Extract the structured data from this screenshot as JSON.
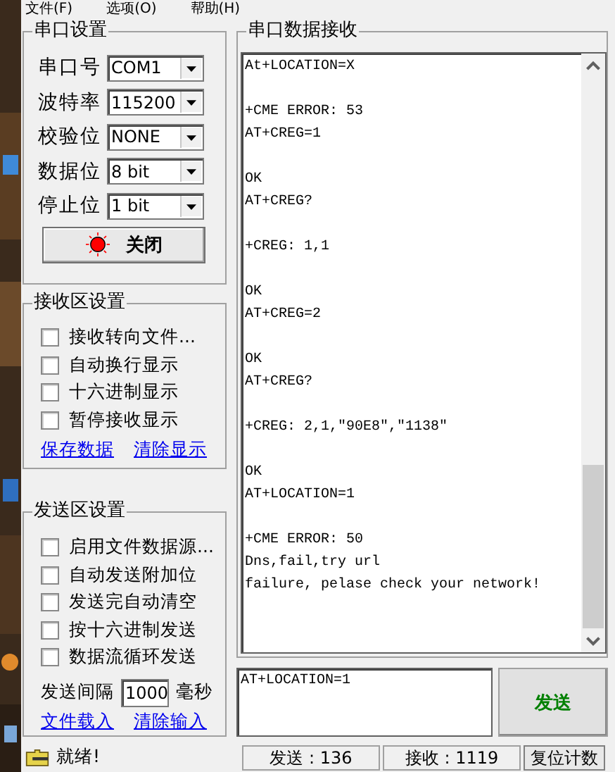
{
  "menu": [
    {
      "label": "文件(F)"
    },
    {
      "label": "选项(O)"
    },
    {
      "label": "帮助(H)"
    }
  ],
  "serial_settings": {
    "title": "串口设置",
    "fields": [
      {
        "label": "串口号",
        "value": "COM1"
      },
      {
        "label": "波特率",
        "value": "115200"
      },
      {
        "label": "校验位",
        "value": "NONE"
      },
      {
        "label": "数据位",
        "value": "8 bit"
      },
      {
        "label": "停止位",
        "value": "1 bit"
      }
    ],
    "port_button": {
      "label": "关闭",
      "on": true
    }
  },
  "receive_settings": {
    "title": "接收区设置",
    "options": [
      {
        "label": "接收转向文件...",
        "checked": false
      },
      {
        "label": "自动换行显示",
        "checked": false
      },
      {
        "label": "十六进制显示",
        "checked": false
      },
      {
        "label": "暂停接收显示",
        "checked": false
      }
    ],
    "links": [
      "保存数据",
      "清除显示"
    ]
  },
  "send_settings": {
    "title": "发送区设置",
    "options": [
      {
        "label": "启用文件数据源...",
        "checked": false
      },
      {
        "label": "自动发送附加位",
        "checked": false
      },
      {
        "label": "发送完自动清空",
        "checked": false
      },
      {
        "label": "按十六进制发送",
        "checked": false
      },
      {
        "label": "数据流循环发送",
        "checked": false
      }
    ],
    "interval": {
      "label": "发送间隔",
      "value": "1000",
      "unit": "毫秒"
    },
    "links": [
      "文件载入",
      "清除输入"
    ]
  },
  "receive_panel": {
    "title": "串口数据接收",
    "blocks": [
      {
        "lines": [
          "At+LOCATION=X"
        ]
      },
      {
        "lines": [
          "+CME ERROR: 53",
          "AT+CREG=1"
        ]
      },
      {
        "lines": [
          "OK",
          "AT+CREG?"
        ]
      },
      {
        "lines": [
          "+CREG: 1,1"
        ]
      },
      {
        "lines": [
          "OK",
          "AT+CREG=2"
        ]
      },
      {
        "lines": [
          "OK",
          "AT+CREG?"
        ]
      },
      {
        "lines": [
          "+CREG: 2,1,\"90E8\",\"1138\""
        ]
      },
      {
        "lines": [
          "OK",
          "AT+LOCATION=1"
        ]
      },
      {
        "lines": [
          "+CME ERROR: 50",
          "Dns,fail,try url",
          "failure, pelase check your network!"
        ]
      }
    ]
  },
  "send_input": {
    "value": "AT+LOCATION=1"
  },
  "send_button": {
    "label": "发送"
  },
  "status_bar": {
    "message": "就绪!",
    "counters": [
      "发送 : 136",
      "接收 : 1119"
    ],
    "reset_button": "复位计数"
  }
}
